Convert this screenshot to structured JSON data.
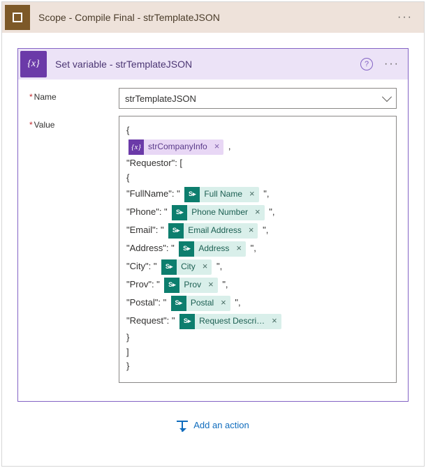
{
  "scope": {
    "title": "Scope - Compile Final - strTemplateJSON"
  },
  "action": {
    "title": "Set variable - strTemplateJSON",
    "name_label": "Name",
    "value_label": "Value",
    "name_value": "strTemplateJSON"
  },
  "value_lines": {
    "l0": "{",
    "l1b": " ,",
    "l2": "\"Requestor\": [",
    "l3": "{",
    "l4a": "\"FullName\": \" ",
    "l4b": " \",",
    "l5a": "\"Phone\": \" ",
    "l5b": " \",",
    "l6a": "\"Email\": \" ",
    "l6b": " \",",
    "l7a": "\"Address\": \" ",
    "l7b": " \",",
    "l8a": "\"City\": \" ",
    "l8b": " \",",
    "l9a": "\"Prov\": \" ",
    "l9b": " \",",
    "l10a": "\"Postal\": \" ",
    "l10b": " \",",
    "l11a": "\"Request\": \" ",
    "l12": "}",
    "l13": "]",
    "l14": "}"
  },
  "tokens": {
    "company": "strCompanyInfo",
    "fullname": "Full Name",
    "phone": "Phone Number",
    "email": "Email Address",
    "address": "Address",
    "city": "City",
    "prov": "Prov",
    "postal": "Postal",
    "request": "Request Descri…"
  },
  "footer": {
    "add_action": "Add an action"
  }
}
